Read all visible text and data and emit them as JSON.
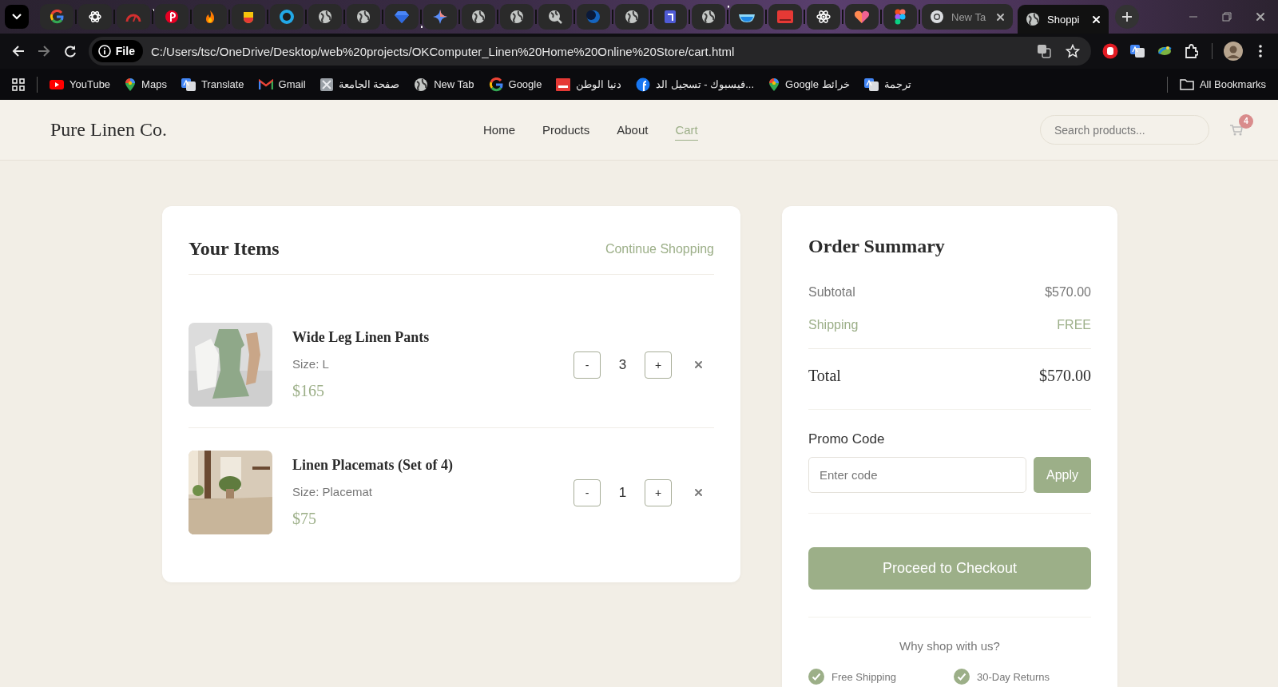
{
  "browser": {
    "tabs": [
      {
        "kind": "pinned",
        "selected": false
      },
      {
        "kind": "pinned",
        "selected": false
      },
      {
        "kind": "pinned",
        "selected": false
      },
      {
        "kind": "pinned",
        "selected": false
      },
      {
        "kind": "pinned",
        "selected": false
      },
      {
        "kind": "pinned",
        "selected": false
      },
      {
        "kind": "pinned",
        "selected": false
      },
      {
        "kind": "pinned",
        "selected": false
      },
      {
        "kind": "pinned",
        "selected": false
      },
      {
        "kind": "pinned",
        "selected": false
      },
      {
        "kind": "pinned",
        "selected": false
      },
      {
        "kind": "pinned",
        "selected": false
      },
      {
        "kind": "pinned",
        "selected": false
      },
      {
        "kind": "pinned",
        "selected": false
      },
      {
        "kind": "pinned",
        "selected": false
      },
      {
        "kind": "pinned",
        "selected": false
      },
      {
        "kind": "pinned",
        "selected": false
      },
      {
        "kind": "pinned",
        "selected": false
      },
      {
        "kind": "pinned",
        "selected": false
      },
      {
        "kind": "pinned",
        "selected": false
      },
      {
        "kind": "pinned",
        "selected": false
      },
      {
        "kind": "pinned",
        "selected": false
      },
      {
        "kind": "pinned",
        "selected": false
      },
      {
        "kind": "page",
        "title": "New Ta",
        "selected": false
      },
      {
        "kind": "page",
        "title": "Shoppi",
        "selected": true
      }
    ],
    "address": {
      "scheme": "File",
      "url": "C:/Users/tsc/OneDrive/Desktop/web%20projects/OKComputer_Linen%20Home%20Online%20Store/cart.html"
    },
    "bookmarks": [
      {
        "label": "YouTube"
      },
      {
        "label": "Maps"
      },
      {
        "label": "Translate"
      },
      {
        "label": "Gmail"
      },
      {
        "label": "صفحة الجامعة"
      },
      {
        "label": "New Tab"
      },
      {
        "label": "Google"
      },
      {
        "label": "دنيا الوطن"
      },
      {
        "label": "فيسبوك - تسجيل الد..."
      },
      {
        "label": "Google خرائط"
      },
      {
        "label": "ترجمة"
      }
    ],
    "all_bookmarks": "All Bookmarks"
  },
  "site": {
    "logo": "Pure Linen Co.",
    "nav": [
      {
        "label": "Home",
        "selected": false
      },
      {
        "label": "Products",
        "selected": false
      },
      {
        "label": "About",
        "selected": false
      },
      {
        "label": "Cart",
        "selected": true
      }
    ],
    "search": {
      "placeholder": "Search products..."
    },
    "cart_badge": "4"
  },
  "cart": {
    "title": "Your Items",
    "continue_link": "Continue Shopping",
    "items": [
      {
        "name": "Wide Leg Linen Pants",
        "size": "Size: L",
        "price": "$165",
        "decrease": "-",
        "quantity": "3",
        "increase": "+"
      },
      {
        "name": "Linen Placemats (Set of 4)",
        "size": "Size: Placemat",
        "price": "$75",
        "decrease": "-",
        "quantity": "1",
        "increase": "+"
      }
    ]
  },
  "summary": {
    "title": "Order Summary",
    "lines": [
      {
        "kind": "plain",
        "label": "Subtotal",
        "value": "$570.00"
      },
      {
        "kind": "accent",
        "label": "Shipping",
        "value": "FREE"
      }
    ],
    "total": {
      "label": "Total",
      "value": "$570.00"
    },
    "promo": {
      "label": "Promo Code",
      "placeholder": "Enter code",
      "button": "Apply"
    },
    "checkout": "Proceed to Checkout",
    "why": "Why shop with us?",
    "features": [
      "Free Shipping",
      "30-Day Returns"
    ]
  }
}
